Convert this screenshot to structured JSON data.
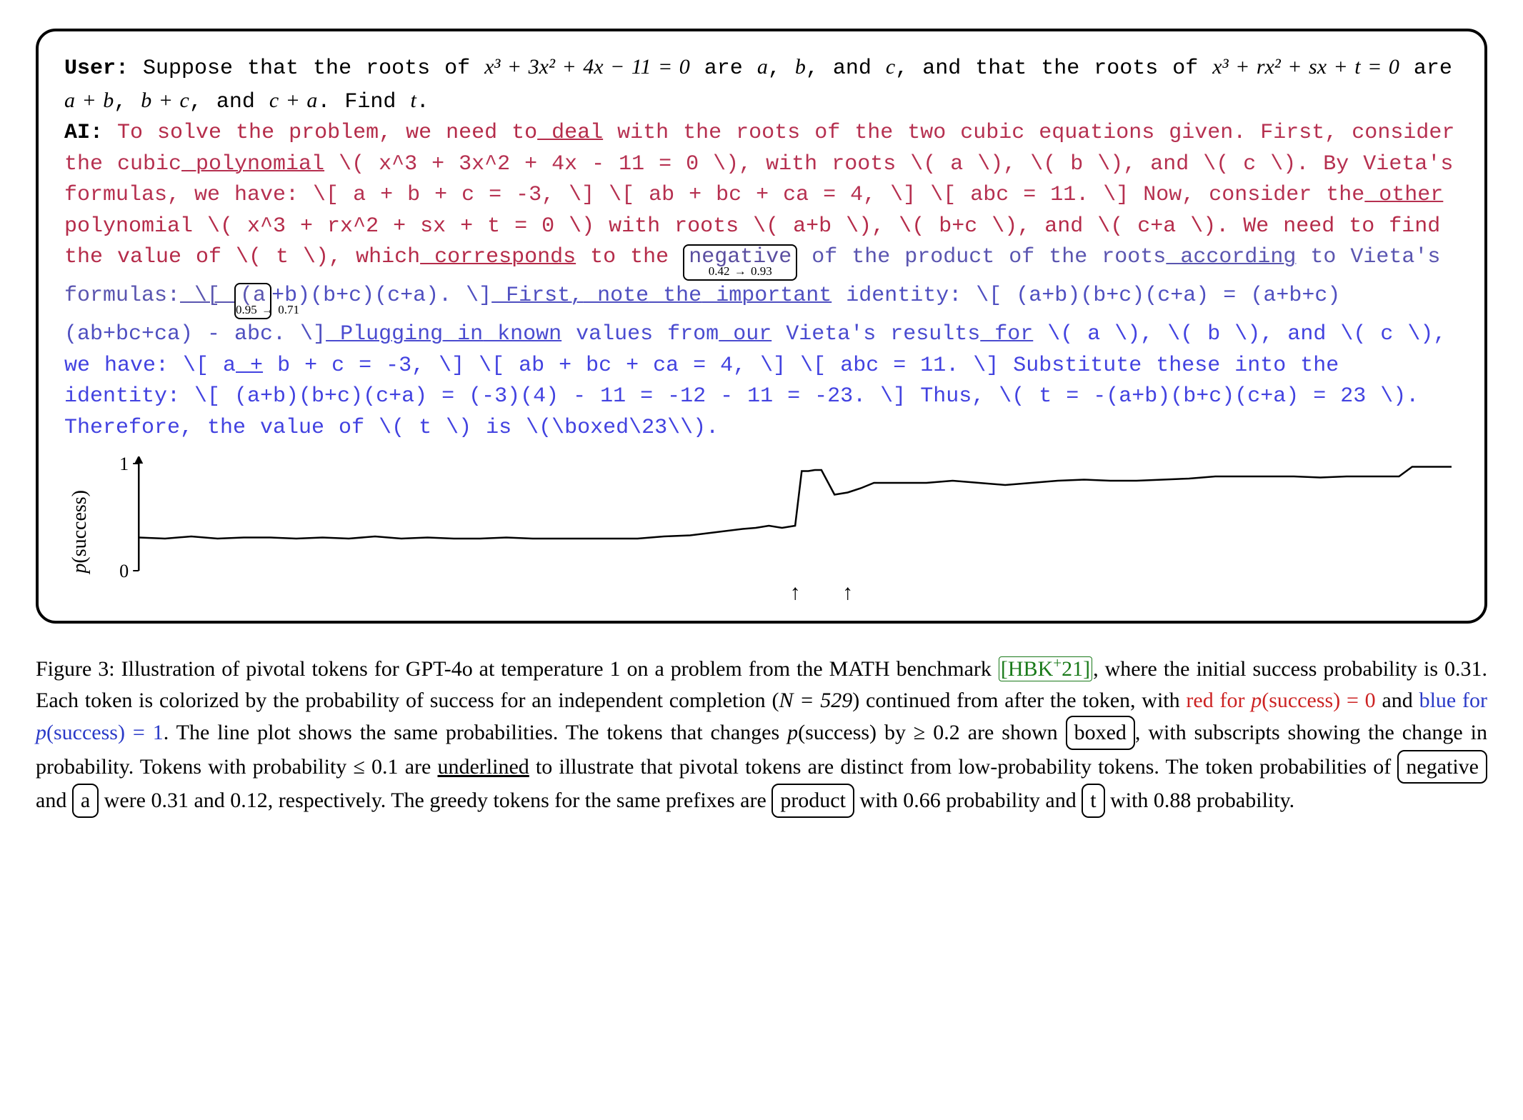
{
  "user_label": "User:",
  "ai_label": "AI:",
  "problem_text_pre": " Suppose that the roots of ",
  "problem_poly1": "x³ + 3x² + 4x − 11 = 0",
  "problem_text_mid1": " are ",
  "pvar_a": "a",
  "pvar_b": "b",
  "pvar_c": "c",
  "problem_text_mid2": ", and ",
  "problem_text_mid3": ", and that the roots of ",
  "problem_poly2": "x³ + rx² + sx + t = 0",
  "problem_text_mid4": " are ",
  "pvar_ab": "a + b",
  "pvar_bc": "b + c",
  "pvar_ca": "c + a",
  "problem_text_end": ". Find ",
  "pvar_t": "t",
  "period": ".",
  "comma": ", ",
  "box1": {
    "word": "negative",
    "sub": "0.42 → 0.93"
  },
  "box2": {
    "word": "(a",
    "sub": "0.95 → 0.71"
  },
  "seg": {
    "a1": "To solve the problem, we need to",
    "a2": " deal",
    "a3": " with the roots of the two cubic equations given.  First, consider the cubic",
    "a4": " polynomial",
    "a5": " \\( x^3 + 3x^2 + 4x - 11 = 0 \\), with roots \\( a \\), \\( b \\), and \\( c \\).  By Vieta's formulas, we have:  \\[ a + b + c = -3, \\] \\[ ab + bc + ca = 4, \\] \\[ abc = 11.  \\] Now, consider the",
    "a6": " other",
    "a7": " polynomial \\( x^3 + rx^2 + sx + t = 0 \\) with roots \\( a+b \\), \\( b+c \\), and \\( c+a \\).  We need to find the value of \\( t \\), which",
    "a8": " corresponds",
    "a9": " to the",
    "b1": " of the product of the roots",
    "b2": " according",
    "b3": " to Vieta's formulas:",
    "b4": "   \\[  ",
    "b5": "+b)(b+c)(c+a). \\]",
    "b6": " First,",
    "b7": " note",
    "b8": " the",
    "b9": " important",
    "b10": " identity:  \\[ (a+b)(b+c)(c+a) = (a+b+c)(ab+bc+ca) - abc.  \\]",
    "b11": " Plugging",
    "b12": " in",
    "b13": " known",
    "b14": " values from",
    "b15": " our",
    "b16": " Vieta's results",
    "b17": " for",
    "b18": " \\( a \\), \\( b \\), and \\( c \\), we have:  \\[ a",
    "b19": " +",
    "b20": " b + c = -3, \\] \\[ ab + bc + ca = 4, \\] \\[ abc = 11.  \\] Substitute these into the identity:  \\[ (a+b)(b+c)(c+a) = (-3)(4) - 11 = -12 - 11 = -23.  \\] Thus, \\( t = -(a+b)(b+c)(c+a) = 23 \\).  Therefore, the value of \\( t \\) is \\(\\boxed\\23\\\\)."
  },
  "colors": {
    "a1": "#b52c4a",
    "a2": "#b52c4a",
    "a3": "#b63050",
    "a4": "#b63050",
    "a5": "#b63050",
    "a6": "#b63050",
    "a7": "#b52c4a",
    "a8": "#b52c4a",
    "a9": "#b52c4a",
    "box1": "#5a4ea0",
    "b1": "#5a55b0",
    "b2": "#5a55b0",
    "b3": "#5a55b0",
    "b4": "#5a55b0",
    "box2": "#5a55b0",
    "b5": "#4f4fc0",
    "b6": "#4f4fc0",
    "b7": "#4f4fc0",
    "b8": "#4f4fc0",
    "b9": "#4f4fc0",
    "b10": "#4f4fc0",
    "b11": "#4a4bd0",
    "b12": "#4a4bd0",
    "b13": "#4a4bd0",
    "b14": "#4a4bd0",
    "b15": "#4a4bd0",
    "b16": "#4a4bd0",
    "b17": "#4a4bd0",
    "b18": "#4242e0",
    "b19": "#4242e0",
    "b20": "#4242e0"
  },
  "chart_data": {
    "type": "line",
    "title": "",
    "xlabel": "",
    "ylabel": "p(success)",
    "ylim": [
      0,
      1
    ],
    "y_ticks": [
      0,
      1
    ],
    "x": [
      0,
      0.02,
      0.04,
      0.06,
      0.08,
      0.1,
      0.12,
      0.14,
      0.16,
      0.18,
      0.2,
      0.22,
      0.24,
      0.26,
      0.28,
      0.3,
      0.32,
      0.34,
      0.36,
      0.38,
      0.4,
      0.42,
      0.44,
      0.46,
      0.47,
      0.48,
      0.49,
      0.5,
      0.505,
      0.51,
      0.515,
      0.52,
      0.53,
      0.54,
      0.55,
      0.56,
      0.58,
      0.6,
      0.62,
      0.64,
      0.66,
      0.68,
      0.7,
      0.72,
      0.74,
      0.76,
      0.78,
      0.8,
      0.82,
      0.84,
      0.86,
      0.88,
      0.9,
      0.92,
      0.94,
      0.96,
      0.97,
      1.0
    ],
    "values": [
      0.31,
      0.3,
      0.32,
      0.3,
      0.31,
      0.31,
      0.3,
      0.31,
      0.3,
      0.32,
      0.3,
      0.31,
      0.3,
      0.3,
      0.31,
      0.3,
      0.3,
      0.3,
      0.3,
      0.3,
      0.32,
      0.33,
      0.36,
      0.39,
      0.4,
      0.42,
      0.4,
      0.42,
      0.93,
      0.93,
      0.94,
      0.94,
      0.71,
      0.73,
      0.77,
      0.82,
      0.82,
      0.82,
      0.84,
      0.82,
      0.8,
      0.82,
      0.84,
      0.85,
      0.84,
      0.84,
      0.85,
      0.86,
      0.88,
      0.88,
      0.88,
      0.88,
      0.87,
      0.88,
      0.88,
      0.88,
      0.97,
      0.97
    ],
    "arrows_x": [
      0.5,
      0.54
    ]
  },
  "caption": {
    "pre": "Figure 3: Illustration of pivotal tokens for GPT-4o at temperature 1 on a problem from the MATH benchmark ",
    "cite": "[HBK",
    "cite_sup": "+",
    "cite_tail": "21]",
    "after_cite": ", where the initial success probability is 0.31. Each token is colorized by the probability of success for an independent completion (",
    "N_eq": "N = 529",
    "after_N": ") continued from after the token, with ",
    "red_phrase": "red for p(success) = 0",
    "and_word": " and ",
    "blue_phrase": "blue for p(success) = 1",
    "line2": ". The line plot shows the same probabilities. The tokens that changes ",
    "psuccess": "p(success)",
    "line2b": " by ≥ 0.2 are shown ",
    "boxed_word": "boxed",
    "line2c": ", with subscripts showing the change in probability. Tokens with probability ≤ 0.1 are ",
    "underlined_word": "underlined",
    "line2d": " to illustrate that pivotal tokens are distinct from low-probability tokens. The token probabilities of ",
    "neg_word": " negative",
    "and2": " and ",
    "a_word": "a",
    "line3": " were 0.31 and 0.12, respectively. The greedy tokens for the same prefixes are ",
    "product_word": " product",
    "line3b": " with 0.66 probability and ",
    "t_word": "t",
    "line3c": " with 0.88 probability."
  }
}
